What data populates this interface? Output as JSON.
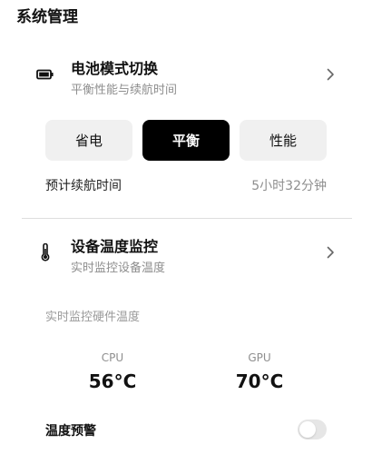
{
  "section_title": "系统管理",
  "battery_mode": {
    "title": "电池模式切换",
    "subtitle": "平衡性能与续航时间",
    "icon": "battery-icon",
    "options": [
      "省电",
      "平衡",
      "性能"
    ],
    "selected": "平衡"
  },
  "battery_life": {
    "label": "预计续航时间",
    "value": "5小时32分钟"
  },
  "temperature": {
    "title": "设备温度监控",
    "subtitle": "实时监控设备温度",
    "icon": "thermometer-icon",
    "caption": "实时监控硬件温度",
    "cpu": {
      "label": "CPU",
      "value": "56°C"
    },
    "gpu": {
      "label": "GPU",
      "value": "70°C"
    }
  },
  "warning": {
    "label": "温度预警",
    "enabled": false
  },
  "colors": {
    "accent": "#000000",
    "muted_text": "#8e8e8e",
    "segment_bg": "#f0f0f0",
    "toggle_off": "#e6e6e6"
  }
}
